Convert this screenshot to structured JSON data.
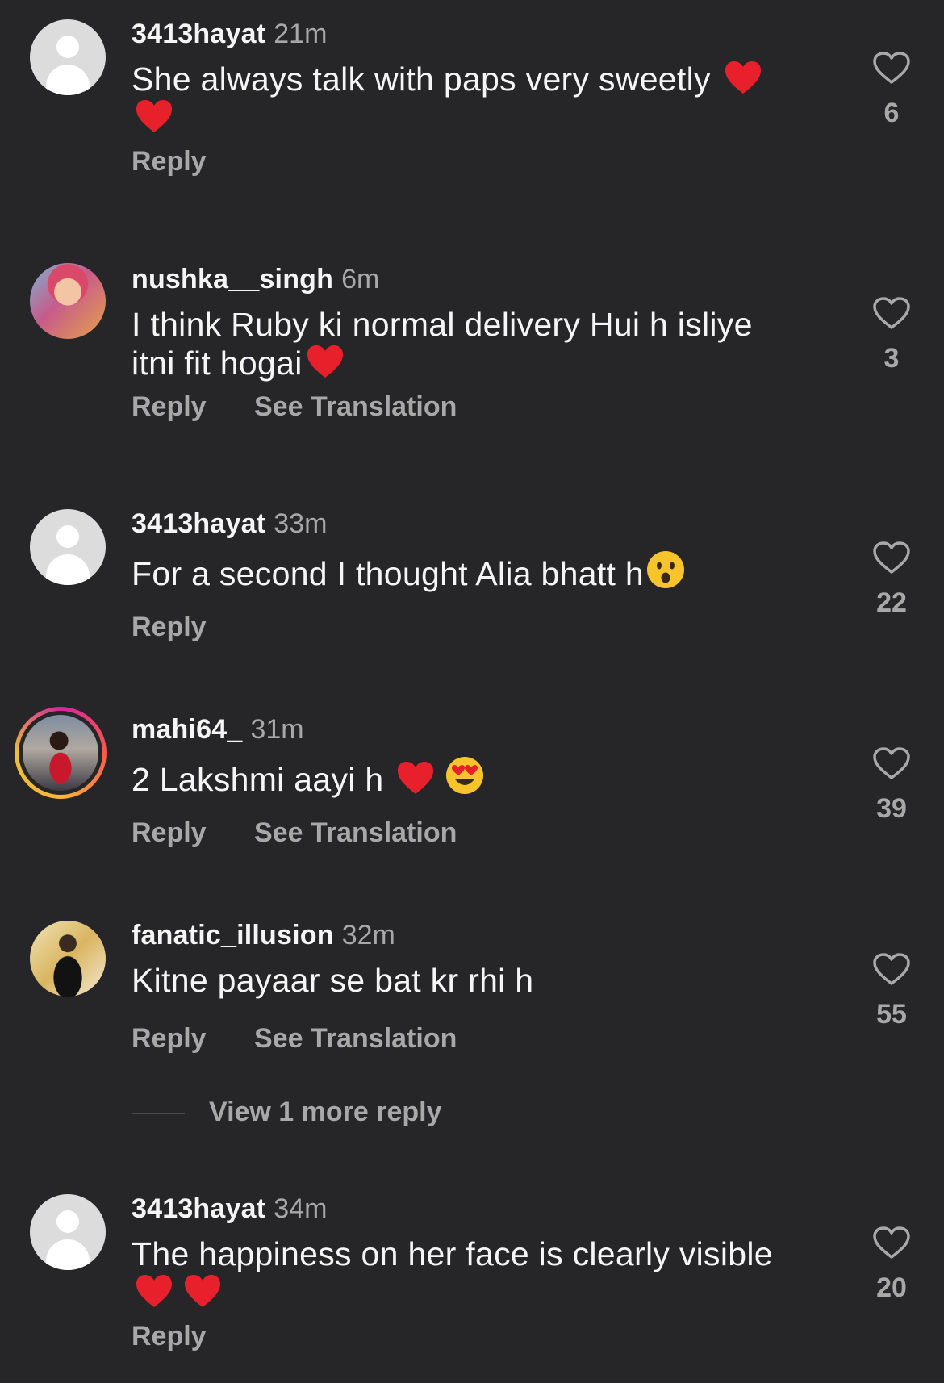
{
  "comments": [
    {
      "username": "3413hayat",
      "time": "21m",
      "text": "She always talk with paps very sweetly",
      "reply_label": "Reply",
      "likes": "6",
      "avatar_icon": "default-avatar-icon",
      "emoji": [
        "red-heart",
        "red-heart"
      ]
    },
    {
      "username": "nushka__singh",
      "time": "6m",
      "text_line1": "I think Ruby ki normal delivery Hui h isliye",
      "text_line2": "itni fit hogai",
      "reply_label": "Reply",
      "translate_label": "See Translation",
      "likes": "3",
      "avatar_icon": "profile-photo",
      "emoji": [
        "red-heart"
      ]
    },
    {
      "username": "3413hayat",
      "time": "33m",
      "text": "For a second I thought Alia bhatt h",
      "reply_label": "Reply",
      "likes": "22",
      "avatar_icon": "default-avatar-icon",
      "emoji": [
        "hushed-face"
      ]
    },
    {
      "username": "mahi64_",
      "time": "31m",
      "text": "2 Lakshmi aayi h",
      "reply_label": "Reply",
      "translate_label": "See Translation",
      "likes": "39",
      "avatar_icon": "profile-photo-story-ring",
      "emoji": [
        "red-heart",
        "heart-eyes"
      ]
    },
    {
      "username": "fanatic_illusion",
      "time": "32m",
      "text": "Kitne payaar se bat kr rhi h",
      "reply_label": "Reply",
      "translate_label": "See Translation",
      "likes": "55",
      "avatar_icon": "profile-photo"
    },
    {
      "username": "3413hayat",
      "time": "34m",
      "text": "The happiness on her face is clearly visible",
      "reply_label": "Reply",
      "likes": "20",
      "avatar_icon": "default-avatar-icon",
      "emoji": [
        "red-heart",
        "red-heart"
      ]
    }
  ],
  "view_more_replies": "View 1 more reply",
  "colors": {
    "background": "#262628",
    "primary_text": "#f5f5f5",
    "secondary_text": "#a8a8a8",
    "heart_emoji": "#e8202c"
  }
}
